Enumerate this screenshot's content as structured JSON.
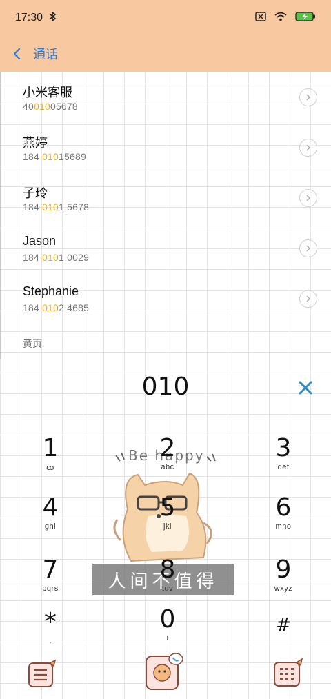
{
  "status": {
    "time": "17:30",
    "icons": [
      "bluetooth-icon",
      "sim-no-service-icon",
      "wifi-icon",
      "battery-charging-icon"
    ]
  },
  "header": {
    "title": "通话",
    "back_icon": "chevron-left-icon",
    "accent": "#2a7ad6",
    "background": "#f8c9a0"
  },
  "contacts": [
    {
      "name": "小米客服",
      "num_pre": "40",
      "num_hl": "010",
      "num_post": "05678"
    },
    {
      "name": "燕婷",
      "num_pre": "184 ",
      "num_hl": "010",
      "num_post": "15689"
    },
    {
      "name": "子玲",
      "num_pre": "184 ",
      "num_hl": "010",
      "num_post": "1 5678"
    },
    {
      "name": "Jason",
      "num_pre": "184 ",
      "num_hl": "010",
      "num_post": "1 0029"
    },
    {
      "name": "Stephanie",
      "num_pre": "184 ",
      "num_hl": "010",
      "num_post": "2 4685"
    }
  ],
  "highlight_color": "#e8b021",
  "yellow_pages": "黄页",
  "dialer": {
    "input": "010",
    "clear_icon": "close-icon",
    "keys": [
      {
        "digit": "1",
        "letters": "ꝏ"
      },
      {
        "digit": "2",
        "letters": "abc"
      },
      {
        "digit": "3",
        "letters": "def"
      },
      {
        "digit": "4",
        "letters": "ghi"
      },
      {
        "digit": "5",
        "letters": "jkl"
      },
      {
        "digit": "6",
        "letters": "mno"
      },
      {
        "digit": "7",
        "letters": "pqrs"
      },
      {
        "digit": "8",
        "letters": "tuv"
      },
      {
        "digit": "9",
        "letters": "wxyz"
      },
      {
        "digit": "*",
        "letters": ","
      },
      {
        "digit": "0",
        "letters": "+"
      },
      {
        "digit": "#",
        "letters": ""
      }
    ]
  },
  "sticker": {
    "top_text": "Be happy",
    "banner_text": "人间不值得"
  },
  "bottom_bar": {
    "menu_icon": "menu-icon",
    "call_icon": "call-icon",
    "keypad_icon": "dialpad-icon"
  }
}
